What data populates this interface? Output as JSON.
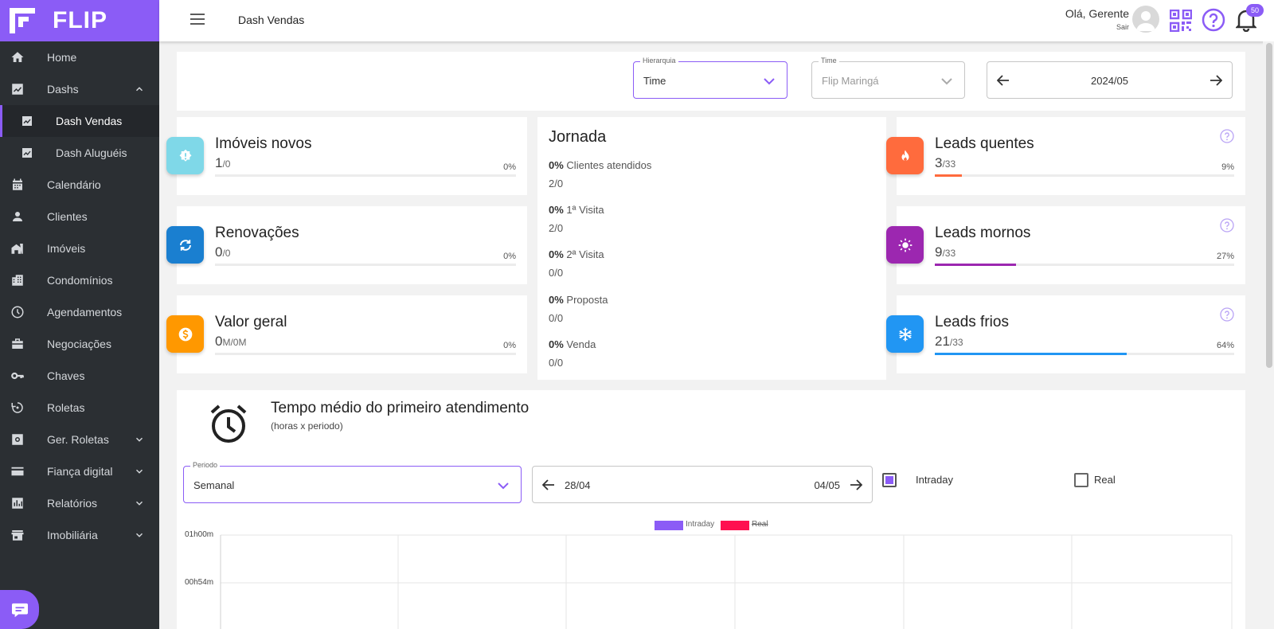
{
  "brand": {
    "name": "FLIP"
  },
  "sidebar": {
    "items": [
      {
        "label": "Home"
      },
      {
        "label": "Dashs"
      },
      {
        "label": "Dash Vendas"
      },
      {
        "label": "Dash Aluguéis"
      },
      {
        "label": "Calendário"
      },
      {
        "label": "Clientes"
      },
      {
        "label": "Imóveis"
      },
      {
        "label": "Condomínios"
      },
      {
        "label": "Agendamentos"
      },
      {
        "label": "Negociações"
      },
      {
        "label": "Chaves"
      },
      {
        "label": "Roletas"
      },
      {
        "label": "Ger. Roletas"
      },
      {
        "label": "Fiança digital"
      },
      {
        "label": "Relatórios"
      },
      {
        "label": "Imobiliária"
      }
    ]
  },
  "header": {
    "title": "Dash Vendas",
    "greeting": "Olá, Gerente",
    "logout": "Sair",
    "notifications": "50"
  },
  "filters": {
    "hierarquia": {
      "label": "Hierarquia",
      "value": "Time"
    },
    "time": {
      "label": "Time",
      "value": "Flip Maringá"
    },
    "period": {
      "value": "2024/05"
    }
  },
  "stats": {
    "imoveis": {
      "title": "Imóveis novos",
      "value": "1",
      "total": "/0",
      "pct": "0%",
      "fill": 0
    },
    "renovacoes": {
      "title": "Renovações",
      "value": "0",
      "total": "/0",
      "pct": "0%",
      "fill": 0
    },
    "valor": {
      "title": "Valor geral",
      "value": "0",
      "total": "M/0M",
      "pct": "0%",
      "fill": 0
    },
    "quentes": {
      "title": "Leads quentes",
      "value": "3",
      "total": "/33",
      "pct": "9%",
      "fill": 9
    },
    "mornos": {
      "title": "Leads mornos",
      "value": "9",
      "total": "/33",
      "pct": "27%",
      "fill": 27
    },
    "frios": {
      "title": "Leads frios",
      "value": "21",
      "total": "/33",
      "pct": "64%",
      "fill": 64
    }
  },
  "jornada": {
    "title": "Jornada",
    "rows": [
      {
        "pct": "0%",
        "label": "Clientes atendidos",
        "count": "2/0"
      },
      {
        "pct": "0%",
        "label": "1ª Visita",
        "count": "2/0"
      },
      {
        "pct": "0%",
        "label": "2ª Visita",
        "count": "0/0"
      },
      {
        "pct": "0%",
        "label": "Proposta",
        "count": "0/0"
      },
      {
        "pct": "0%",
        "label": "Venda",
        "count": "0/0"
      }
    ]
  },
  "tempo": {
    "title": "Tempo médio do primeiro atendimento",
    "subtitle": "(horas x periodo)",
    "periodo": {
      "label": "Periodo",
      "value": "Semanal"
    },
    "range": {
      "start": "28/04",
      "end": "04/05"
    },
    "intraday": {
      "label": "Intraday",
      "checked": true
    },
    "real": {
      "label": "Real",
      "checked": false
    }
  },
  "chart_data": {
    "type": "line",
    "series": [
      {
        "name": "Intraday",
        "values": []
      },
      {
        "name": "Real",
        "values": []
      }
    ],
    "ytick_labels": [
      "01h00m",
      "00h54m"
    ],
    "legend_placement": "top-center",
    "grid": true
  },
  "colors": {
    "accent": "#8b5cf6",
    "imoveis": "#7fd8e8",
    "renovacoes": "#1a7fd0",
    "valor": "#ff9800",
    "quentes": "#ff6b3d",
    "mornos": "#9c27b0",
    "frios": "#2196f3",
    "intraday": "#8b5cf6",
    "real": "#ff1050"
  }
}
